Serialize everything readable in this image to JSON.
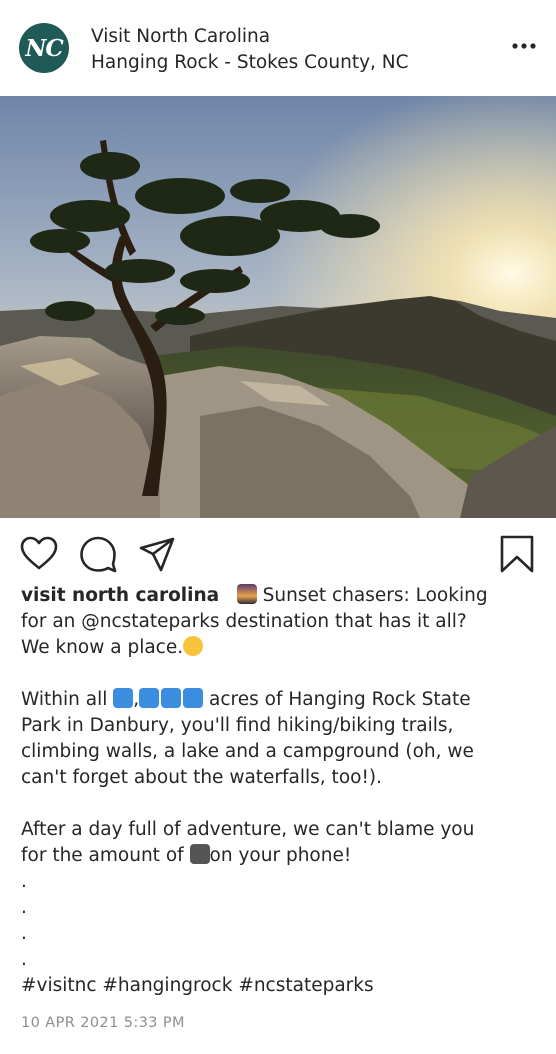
{
  "post": {
    "avatar_text": "NC",
    "account_name": "Visit North Carolina",
    "location": "Hanging Rock - Stokes County, NC",
    "more_icon": "more-options-icon",
    "photo_alt": "tree on rocky cliff at sunset",
    "actions": [
      "heart-icon",
      "comment-icon",
      "share-icon",
      "bookmark-icon"
    ]
  },
  "caption": {
    "username": "visit north carolina",
    "line1_text": "Sunset chasers: Looking",
    "line2_text": "for an @ncstateparks destination that has it all?",
    "line3_text": "We know a place.",
    "para2_a": "Within all",
    "para2_b": ",",
    "para2_c": "acres of Hanging Rock State",
    "para2_line2": "Park in Danbury, you'll find hiking/biking trails,",
    "para2_line3": "climbing walls, a lake and a campground (oh, we",
    "para2_line4": "can't forget about the waterfalls, too!).",
    "para3_line1": "After a day full of adventure, we can't blame you",
    "para3_a": "for the amount of",
    "para3_b": "on your phone!",
    "dots": [
      ".",
      ".",
      ".",
      "."
    ],
    "hashtags": "#visitnc #hangingrock #ncstateparks"
  },
  "timestamp": "10 APR 2021 5:33 PM",
  "colors": {
    "brand": "#1f5a57",
    "text": "#262626",
    "muted": "#8e8e8e"
  }
}
